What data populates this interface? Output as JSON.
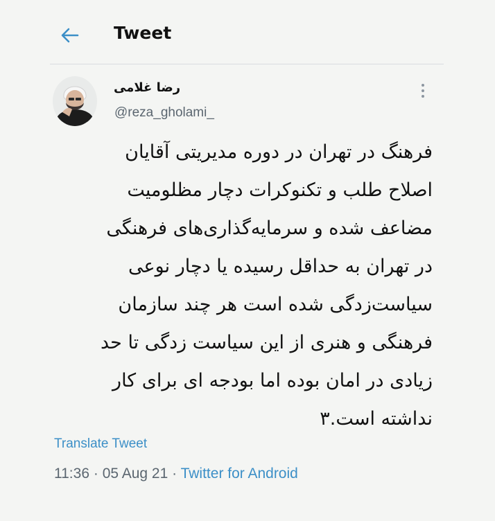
{
  "header": {
    "title": "Tweet"
  },
  "tweet": {
    "author_name": "رضا غلامی",
    "author_handle": "@reza_gholami_",
    "lines": [
      "فرهنگ در تهران در دوره مدیریتی آقایان",
      "اصلاح طلب و تکنوکرات دچار مظلومیت",
      "مضاعف شده و سرمایه‌گذاری‌های فرهنگی",
      "در تهران به حداقل رسیده یا دچار نوعی",
      "سیاست‌زدگی شده است هر چند سازمان",
      "فرهنگی و هنری از این سیاست زدگی تا حد",
      "زیادی در امان بوده اما بودجه ای برای کار",
      "نداشته است.۳"
    ],
    "translate_label": "Translate Tweet",
    "time": "11:36",
    "separator": "·",
    "date": "05 Aug 21",
    "source": "Twitter for Android"
  },
  "colors": {
    "accent": "#3c8fc7",
    "background": "#f4f5f3",
    "secondary_text": "#5b6670"
  },
  "icons": {
    "back": "arrow-left-icon",
    "more": "more-vertical-icon"
  }
}
